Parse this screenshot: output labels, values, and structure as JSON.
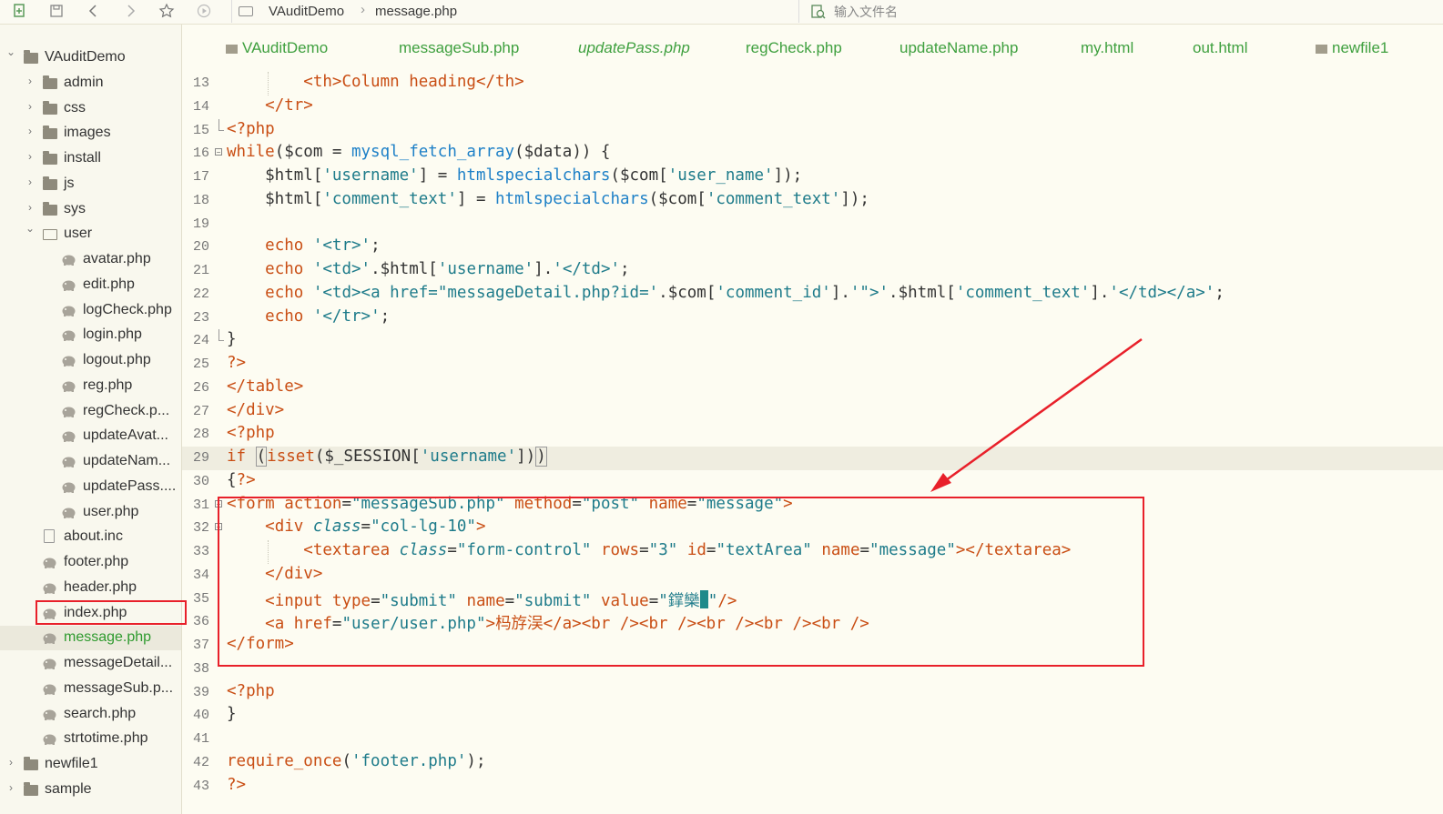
{
  "toolbar": {
    "breadcrumb": [
      "VAuditDemo",
      "message.php"
    ],
    "file_search_placeholder": "输入文件名"
  },
  "sidebar": {
    "items": [
      {
        "label": "VAuditDemo",
        "kind": "folder",
        "expanded": true,
        "depth": 0
      },
      {
        "label": "admin",
        "kind": "folder",
        "expanded": false,
        "depth": 1
      },
      {
        "label": "css",
        "kind": "folder",
        "expanded": false,
        "depth": 1
      },
      {
        "label": "images",
        "kind": "folder",
        "expanded": false,
        "depth": 1
      },
      {
        "label": "install",
        "kind": "folder",
        "expanded": false,
        "depth": 1
      },
      {
        "label": "js",
        "kind": "folder",
        "expanded": false,
        "depth": 1
      },
      {
        "label": "sys",
        "kind": "folder",
        "expanded": false,
        "depth": 1
      },
      {
        "label": "user",
        "kind": "folder",
        "expanded": true,
        "depth": 1
      },
      {
        "label": "avatar.php",
        "kind": "php",
        "depth": 2
      },
      {
        "label": "edit.php",
        "kind": "php",
        "depth": 2
      },
      {
        "label": "logCheck.php",
        "kind": "php",
        "depth": 2
      },
      {
        "label": "login.php",
        "kind": "php",
        "depth": 2
      },
      {
        "label": "logout.php",
        "kind": "php",
        "depth": 2
      },
      {
        "label": "reg.php",
        "kind": "php",
        "depth": 2
      },
      {
        "label": "regCheck.p...",
        "kind": "php",
        "depth": 2
      },
      {
        "label": "updateAvat...",
        "kind": "php",
        "depth": 2
      },
      {
        "label": "updateNam...",
        "kind": "php",
        "depth": 2
      },
      {
        "label": "updatePass....",
        "kind": "php",
        "depth": 2
      },
      {
        "label": "user.php",
        "kind": "php",
        "depth": 2
      },
      {
        "label": "about.inc",
        "kind": "file",
        "depth": 1
      },
      {
        "label": "footer.php",
        "kind": "php",
        "depth": 1
      },
      {
        "label": "header.php",
        "kind": "php",
        "depth": 1
      },
      {
        "label": "index.php",
        "kind": "php",
        "depth": 1
      },
      {
        "label": "message.php",
        "kind": "php",
        "depth": 1,
        "selected": true
      },
      {
        "label": "messageDetail...",
        "kind": "php",
        "depth": 1
      },
      {
        "label": "messageSub.p...",
        "kind": "php",
        "depth": 1
      },
      {
        "label": "search.php",
        "kind": "php",
        "depth": 1
      },
      {
        "label": "strtotime.php",
        "kind": "php",
        "depth": 1
      },
      {
        "label": "newfile1",
        "kind": "folder",
        "expanded": false,
        "depth": 0
      },
      {
        "label": "sample",
        "kind": "folder",
        "expanded": false,
        "depth": 0
      }
    ]
  },
  "tabs": [
    {
      "label": "VAuditDemo",
      "folder": true
    },
    {
      "label": "messageSub.php"
    },
    {
      "label": "updatePass.php",
      "italic": true
    },
    {
      "label": "regCheck.php"
    },
    {
      "label": "updateName.php"
    },
    {
      "label": "my.html"
    },
    {
      "label": "out.html"
    },
    {
      "label": "newfile1",
      "folder": true
    }
  ],
  "editor": {
    "lines": [
      {
        "n": "13",
        "tokens": [
          [
            "        ",
            ""
          ],
          [
            "<th>",
            "tag"
          ],
          [
            "Column heading",
            "cn"
          ],
          [
            "</th>",
            "tag"
          ]
        ]
      },
      {
        "n": "14",
        "tokens": [
          [
            "    ",
            ""
          ],
          [
            "</tr>",
            "tag"
          ]
        ]
      },
      {
        "n": "15",
        "tokens": [
          [
            "<?php",
            "php"
          ]
        ]
      },
      {
        "n": "16",
        "tokens": [
          [
            "while",
            "kw"
          ],
          [
            "($com = ",
            ""
          ],
          [
            "mysql_fetch_array",
            "fn"
          ],
          [
            "($data)) {",
            ""
          ]
        ]
      },
      {
        "n": "17",
        "tokens": [
          [
            "    $html[",
            ""
          ],
          [
            "'username'",
            "str"
          ],
          [
            "] = ",
            ""
          ],
          [
            "htmlspecialchars",
            "fn"
          ],
          [
            "($com[",
            ""
          ],
          [
            "'user_name'",
            "str"
          ],
          [
            "]);",
            ""
          ]
        ]
      },
      {
        "n": "18",
        "tokens": [
          [
            "    $html[",
            ""
          ],
          [
            "'comment_text'",
            "str"
          ],
          [
            "] = ",
            ""
          ],
          [
            "htmlspecialchars",
            "fn"
          ],
          [
            "($com[",
            ""
          ],
          [
            "'comment_text'",
            "str"
          ],
          [
            "]);",
            ""
          ]
        ]
      },
      {
        "n": "19",
        "tokens": []
      },
      {
        "n": "20",
        "tokens": [
          [
            "    ",
            ""
          ],
          [
            "echo",
            "kw"
          ],
          [
            " ",
            ""
          ],
          [
            "'<tr>'",
            "str"
          ],
          [
            ";",
            ""
          ]
        ]
      },
      {
        "n": "21",
        "tokens": [
          [
            "    ",
            ""
          ],
          [
            "echo",
            "kw"
          ],
          [
            " ",
            ""
          ],
          [
            "'<td>'",
            "str"
          ],
          [
            ".$html[",
            ""
          ],
          [
            "'username'",
            "str"
          ],
          [
            "].",
            ""
          ],
          [
            "'</td>'",
            "str"
          ],
          [
            ";",
            ""
          ]
        ]
      },
      {
        "n": "22",
        "tokens": [
          [
            "    ",
            ""
          ],
          [
            "echo",
            "kw"
          ],
          [
            " ",
            ""
          ],
          [
            "'<td><a href=\"messageDetail.php?id='",
            "str"
          ],
          [
            ".$com[",
            ""
          ],
          [
            "'comment_id'",
            "str"
          ],
          [
            "].",
            ""
          ],
          [
            "'\">'",
            "str"
          ],
          [
            ".$html[",
            ""
          ],
          [
            "'comment_text'",
            "str"
          ],
          [
            "].",
            ""
          ],
          [
            "'</td></a>'",
            "str"
          ],
          [
            ";",
            ""
          ]
        ]
      },
      {
        "n": "23",
        "tokens": [
          [
            "    ",
            ""
          ],
          [
            "echo",
            "kw"
          ],
          [
            " ",
            ""
          ],
          [
            "'</tr>'",
            "str"
          ],
          [
            ";",
            ""
          ]
        ]
      },
      {
        "n": "24",
        "tokens": [
          [
            "}",
            ""
          ]
        ]
      },
      {
        "n": "25",
        "tokens": [
          [
            "?>",
            "php"
          ]
        ]
      },
      {
        "n": "26",
        "tokens": [
          [
            "</table>",
            "tag"
          ]
        ]
      },
      {
        "n": "27",
        "tokens": [
          [
            "</div>",
            "tag"
          ]
        ]
      },
      {
        "n": "28",
        "tokens": [
          [
            "<?php",
            "php"
          ]
        ]
      },
      {
        "n": "29",
        "tokens": [
          [
            "if",
            "kw"
          ],
          [
            " ",
            ""
          ],
          [
            "(",
            "pbox"
          ],
          [
            "isset",
            "kw"
          ],
          [
            "($_SESSION[",
            ""
          ],
          [
            "'username'",
            "str"
          ],
          [
            "])",
            ""
          ],
          [
            ")",
            "pbox"
          ]
        ],
        "highlight": true
      },
      {
        "n": "30",
        "tokens": [
          [
            "{",
            ""
          ],
          [
            "?>",
            "php"
          ]
        ]
      },
      {
        "n": "31",
        "tokens": [
          [
            "<form ",
            "tag"
          ],
          [
            "action",
            "attr"
          ],
          [
            "=",
            ""
          ],
          [
            "\"messageSub.php\"",
            "str"
          ],
          [
            " ",
            ""
          ],
          [
            "method",
            "attr"
          ],
          [
            "=",
            ""
          ],
          [
            "\"post\"",
            "str"
          ],
          [
            " ",
            ""
          ],
          [
            "name",
            "attr"
          ],
          [
            "=",
            ""
          ],
          [
            "\"message\"",
            "str"
          ],
          [
            ">",
            "tag"
          ]
        ]
      },
      {
        "n": "32",
        "tokens": [
          [
            "    ",
            ""
          ],
          [
            "<div ",
            "tag"
          ],
          [
            "class",
            "it"
          ],
          [
            "=",
            ""
          ],
          [
            "\"col-lg-10\"",
            "str"
          ],
          [
            ">",
            "tag"
          ]
        ]
      },
      {
        "n": "33",
        "tokens": [
          [
            "        ",
            ""
          ],
          [
            "<textarea ",
            "tag"
          ],
          [
            "class",
            "it"
          ],
          [
            "=",
            ""
          ],
          [
            "\"form-control\"",
            "str"
          ],
          [
            " ",
            ""
          ],
          [
            "rows",
            "attr"
          ],
          [
            "=",
            ""
          ],
          [
            "\"3\"",
            "str"
          ],
          [
            " ",
            ""
          ],
          [
            "id",
            "attr"
          ],
          [
            "=",
            ""
          ],
          [
            "\"textArea\"",
            "str"
          ],
          [
            " ",
            ""
          ],
          [
            "name",
            "attr"
          ],
          [
            "=",
            ""
          ],
          [
            "\"message\"",
            "str"
          ],
          [
            "></textarea>",
            "tag"
          ]
        ]
      },
      {
        "n": "34",
        "tokens": [
          [
            "    ",
            ""
          ],
          [
            "</div>",
            "tag"
          ]
        ]
      },
      {
        "n": "35",
        "tokens": [
          [
            "    ",
            ""
          ],
          [
            "<input ",
            "tag"
          ],
          [
            "type",
            "attr"
          ],
          [
            "=",
            ""
          ],
          [
            "\"submit\"",
            "str"
          ],
          [
            " ",
            ""
          ],
          [
            "name",
            "attr"
          ],
          [
            "=",
            ""
          ],
          [
            "\"submit\"",
            "str"
          ],
          [
            " ",
            ""
          ],
          [
            "value",
            "attr"
          ],
          [
            "=",
            ""
          ],
          [
            "\"鐣欒",
            "str"
          ],
          [
            "█",
            "cursor"
          ],
          [
            "\"",
            "str"
          ],
          [
            "/>",
            "tag"
          ]
        ]
      },
      {
        "n": "36",
        "tokens": [
          [
            "    ",
            ""
          ],
          [
            "<a ",
            "tag"
          ],
          [
            "href",
            "attr"
          ],
          [
            "=",
            ""
          ],
          [
            "\"user/user.php\"",
            "str"
          ],
          [
            ">",
            "tag"
          ],
          [
            "杩斿洖",
            "cn"
          ],
          [
            "</a><br /><br /><br /><br /><br />",
            "tag"
          ]
        ]
      },
      {
        "n": "37",
        "tokens": [
          [
            "</form>",
            "tag"
          ]
        ]
      },
      {
        "n": "38",
        "tokens": []
      },
      {
        "n": "39",
        "tokens": [
          [
            "<?php",
            "php"
          ]
        ]
      },
      {
        "n": "40",
        "tokens": [
          [
            "}",
            ""
          ]
        ]
      },
      {
        "n": "41",
        "tokens": []
      },
      {
        "n": "42",
        "tokens": [
          [
            "require_once",
            "kw"
          ],
          [
            "(",
            ""
          ],
          [
            "'footer.php'",
            "str"
          ],
          [
            ");",
            ""
          ]
        ]
      },
      {
        "n": "43",
        "tokens": [
          [
            "?>",
            "php"
          ]
        ]
      }
    ]
  },
  "colors": {
    "annotation_red": "#e8202a",
    "tab_green": "#3fa03f",
    "tag_orange": "#c94e14",
    "string_teal": "#1e7b8a",
    "function_blue": "#1e80c7"
  }
}
